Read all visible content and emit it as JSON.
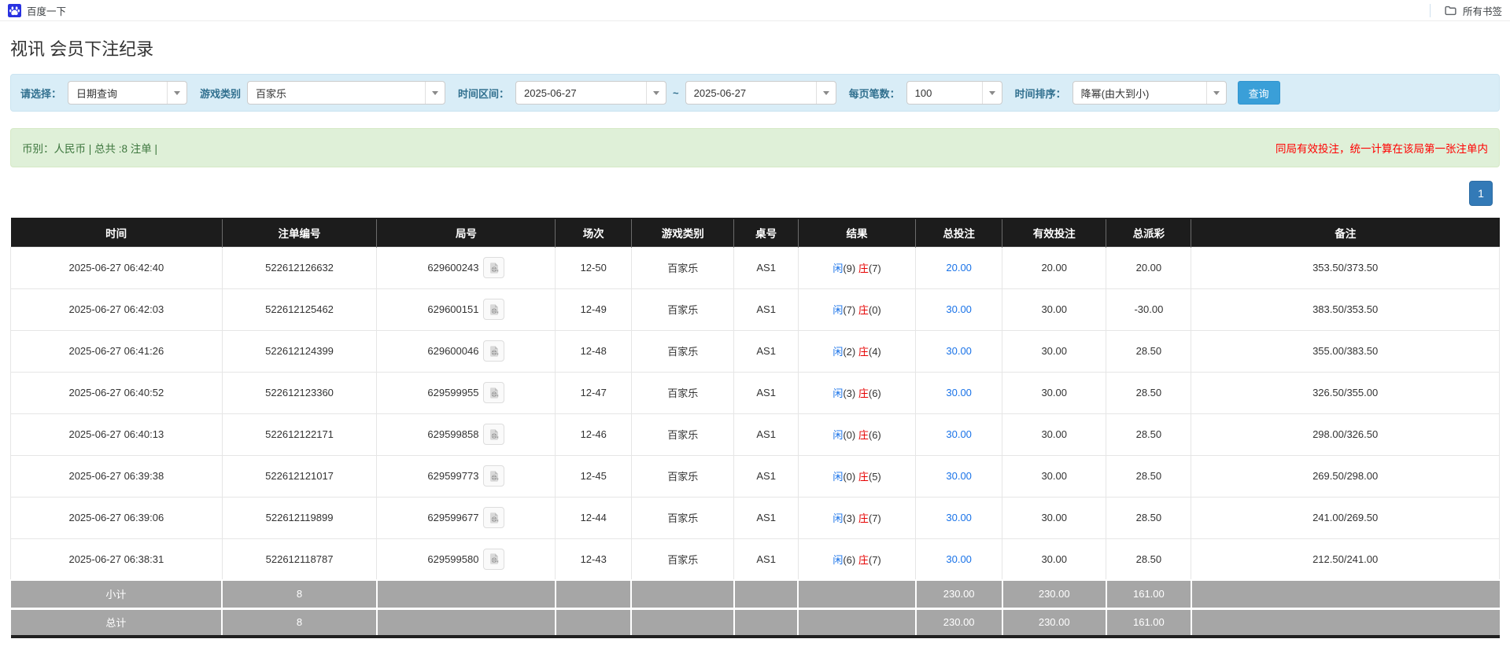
{
  "bookmarks_bar": {
    "baidu_label": "百度一下",
    "all_bookmarks_label": "所有书签"
  },
  "page": {
    "title": "视讯 会员下注纪录"
  },
  "filters": {
    "select_label": "请选择：",
    "select_value": "日期查询",
    "game_type_label": "游戏类别",
    "game_type_value": "百家乐",
    "date_range_label": "时间区间：",
    "date_from": "2025-06-27",
    "date_separator": "~",
    "date_to": "2025-06-27",
    "page_size_label": "每页笔数：",
    "page_size_value": "100",
    "sort_label": "时间排序：",
    "sort_value": "降幂(由大到小)",
    "query_button_label": "查询"
  },
  "summary_bar": {
    "left_text": "币别：人民币 | 总共 :8 注单 |",
    "right_text": "同局有效投注，统一计算在该局第一张注单内"
  },
  "pagination": {
    "current_page": "1"
  },
  "table": {
    "headers": [
      "时间",
      "注单编号",
      "局号",
      "场次",
      "游戏类别",
      "桌号",
      "结果",
      "总投注",
      "有效投注",
      "总派彩",
      "备注"
    ],
    "rows": [
      {
        "time": "2025-06-27 06:42:40",
        "bet_id": "522612126632",
        "round_id": "629600243",
        "session": "12-50",
        "game": "百家乐",
        "table_no": "AS1",
        "result_player_char": "闲",
        "result_player_score": "(9)",
        "result_banker_char": "庄",
        "result_banker_score": "(7)",
        "total_bet": "20.00",
        "valid_bet": "20.00",
        "payout": "20.00",
        "payout_negative": false,
        "note": "353.50/373.50"
      },
      {
        "time": "2025-06-27 06:42:03",
        "bet_id": "522612125462",
        "round_id": "629600151",
        "session": "12-49",
        "game": "百家乐",
        "table_no": "AS1",
        "result_player_char": "闲",
        "result_player_score": "(7)",
        "result_banker_char": "庄",
        "result_banker_score": "(0)",
        "total_bet": "30.00",
        "valid_bet": "30.00",
        "payout": "-30.00",
        "payout_negative": true,
        "note": "383.50/353.50"
      },
      {
        "time": "2025-06-27 06:41:26",
        "bet_id": "522612124399",
        "round_id": "629600046",
        "session": "12-48",
        "game": "百家乐",
        "table_no": "AS1",
        "result_player_char": "闲",
        "result_player_score": "(2)",
        "result_banker_char": "庄",
        "result_banker_score": "(4)",
        "total_bet": "30.00",
        "valid_bet": "30.00",
        "payout": "28.50",
        "payout_negative": false,
        "note": "355.00/383.50"
      },
      {
        "time": "2025-06-27 06:40:52",
        "bet_id": "522612123360",
        "round_id": "629599955",
        "session": "12-47",
        "game": "百家乐",
        "table_no": "AS1",
        "result_player_char": "闲",
        "result_player_score": "(3)",
        "result_banker_char": "庄",
        "result_banker_score": "(6)",
        "total_bet": "30.00",
        "valid_bet": "30.00",
        "payout": "28.50",
        "payout_negative": false,
        "note": "326.50/355.00"
      },
      {
        "time": "2025-06-27 06:40:13",
        "bet_id": "522612122171",
        "round_id": "629599858",
        "session": "12-46",
        "game": "百家乐",
        "table_no": "AS1",
        "result_player_char": "闲",
        "result_player_score": "(0)",
        "result_banker_char": "庄",
        "result_banker_score": "(6)",
        "total_bet": "30.00",
        "valid_bet": "30.00",
        "payout": "28.50",
        "payout_negative": false,
        "note": "298.00/326.50"
      },
      {
        "time": "2025-06-27 06:39:38",
        "bet_id": "522612121017",
        "round_id": "629599773",
        "session": "12-45",
        "game": "百家乐",
        "table_no": "AS1",
        "result_player_char": "闲",
        "result_player_score": "(0)",
        "result_banker_char": "庄",
        "result_banker_score": "(5)",
        "total_bet": "30.00",
        "valid_bet": "30.00",
        "payout": "28.50",
        "payout_negative": false,
        "note": "269.50/298.00"
      },
      {
        "time": "2025-06-27 06:39:06",
        "bet_id": "522612119899",
        "round_id": "629599677",
        "session": "12-44",
        "game": "百家乐",
        "table_no": "AS1",
        "result_player_char": "闲",
        "result_player_score": "(3)",
        "result_banker_char": "庄",
        "result_banker_score": "(7)",
        "total_bet": "30.00",
        "valid_bet": "30.00",
        "payout": "28.50",
        "payout_negative": false,
        "note": "241.00/269.50"
      },
      {
        "time": "2025-06-27 06:38:31",
        "bet_id": "522612118787",
        "round_id": "629599580",
        "session": "12-43",
        "game": "百家乐",
        "table_no": "AS1",
        "result_player_char": "闲",
        "result_player_score": "(6)",
        "result_banker_char": "庄",
        "result_banker_score": "(7)",
        "total_bet": "30.00",
        "valid_bet": "30.00",
        "payout": "28.50",
        "payout_negative": false,
        "note": "212.50/241.00"
      }
    ],
    "subtotal": {
      "label": "小计",
      "count": "8",
      "total_bet": "230.00",
      "valid_bet": "230.00",
      "payout": "161.00"
    },
    "total": {
      "label": "总计",
      "count": "8",
      "total_bet": "230.00",
      "valid_bet": "230.00",
      "payout": "161.00"
    }
  },
  "colors": {
    "filter_bg": "#d9edf7",
    "filter_label": "#31708f",
    "summary_bg": "#dff0d8",
    "summary_text": "#3c763d",
    "warning_red": "#ff0000",
    "header_bg": "#1c1c1c",
    "footer_bg": "#a6a6a6",
    "link_blue": "#1a73e8",
    "banker_red": "#e60000",
    "negative_red": "#e60000",
    "pagination_blue": "#337ab7",
    "query_button_blue": "#3a9fd8",
    "baidu_blue": "#2932e1"
  }
}
